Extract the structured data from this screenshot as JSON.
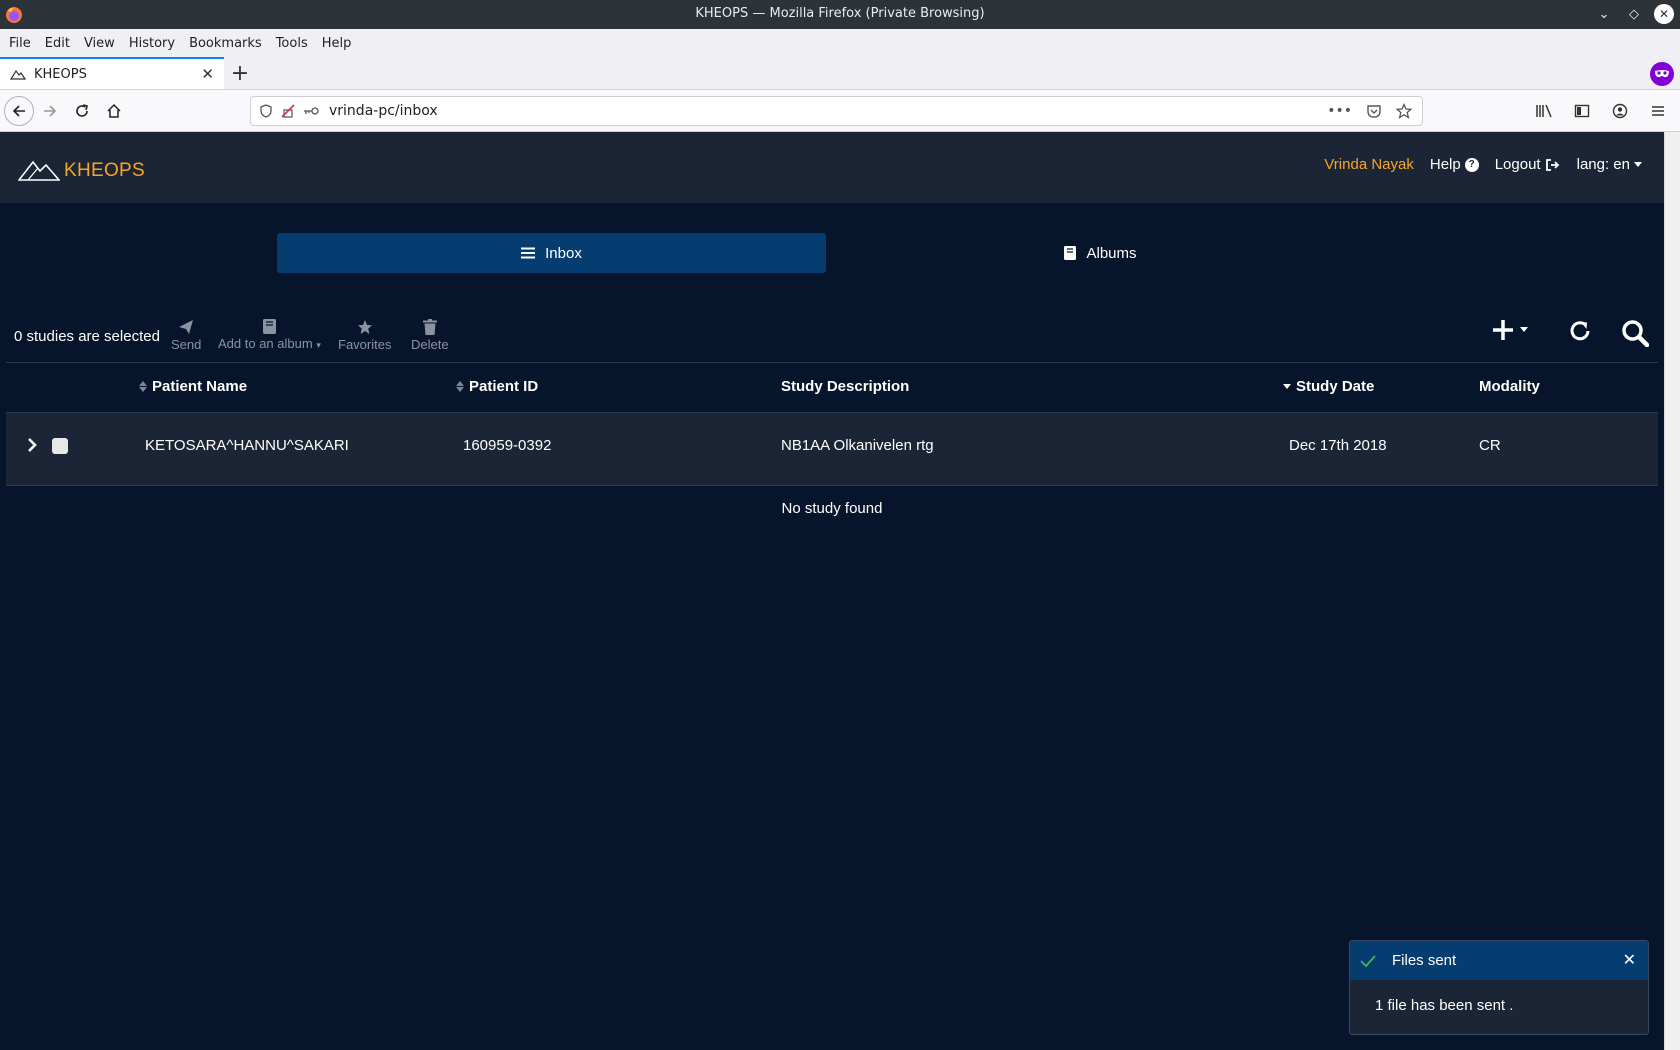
{
  "window": {
    "title": "KHEOPS — Mozilla Firefox (Private Browsing)"
  },
  "menubar": {
    "items": [
      "File",
      "Edit",
      "View",
      "History",
      "Bookmarks",
      "Tools",
      "Help"
    ]
  },
  "browser_tab": {
    "title": "KHEOPS"
  },
  "urlbar": {
    "url": "vrinda-pc/inbox"
  },
  "app": {
    "brand": "KHEOPS",
    "user": "Vrinda Nayak",
    "help_label": "Help",
    "logout_label": "Logout",
    "lang_label": "lang: en",
    "tabs": [
      {
        "label": "Inbox"
      },
      {
        "label": "Albums"
      }
    ],
    "selection_count": "0 studies are selected",
    "tools": {
      "send": "Send",
      "add_album": "Add to an album",
      "favorites": "Favorites",
      "delete": "Delete"
    },
    "columns": {
      "patient_name": "Patient Name",
      "patient_id": "Patient ID",
      "study_description": "Study Description",
      "study_date": "Study Date",
      "modality": "Modality"
    },
    "rows": [
      {
        "patient_name": "KETOSARA^HANNU^SAKARI",
        "patient_id": "160959-0392",
        "study_description": "NB1AA Olkanivelen rtg",
        "study_date": "Dec 17th 2018",
        "modality": "CR"
      }
    ],
    "no_study": "No study found",
    "toast": {
      "title": "Files sent",
      "message": "1 file has been sent ."
    }
  },
  "colors": {
    "app_bg": "#06152b",
    "header_bg": "#1b2535",
    "accent": "#f5a623",
    "active_tab": "#063d70",
    "toast_check": "#3cba54"
  }
}
